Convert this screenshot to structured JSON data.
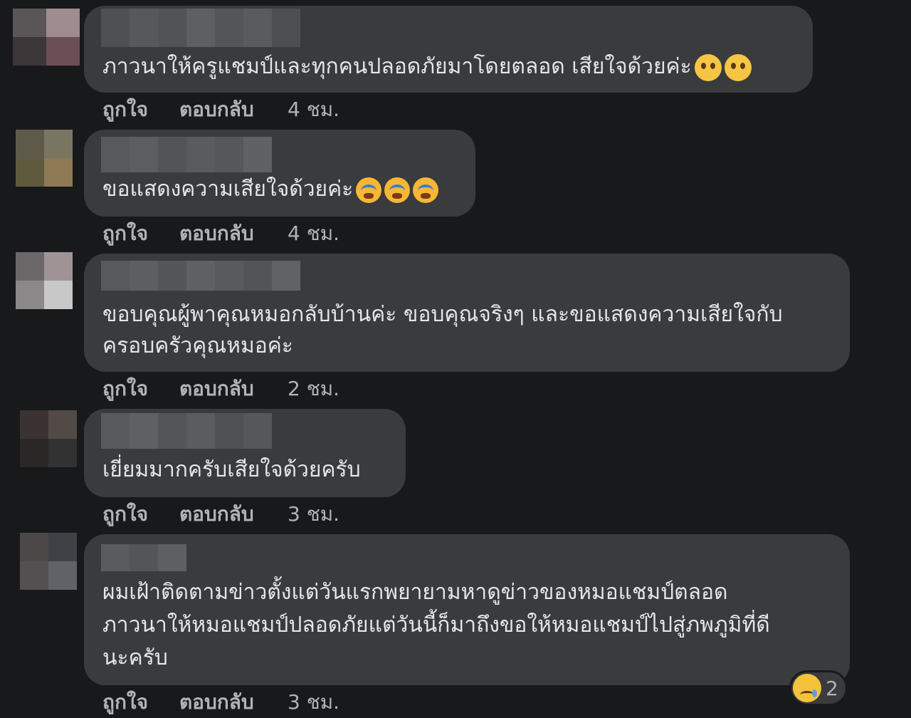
{
  "actions": {
    "like": "ถูกใจ",
    "reply": "ตอบกลับ"
  },
  "comments": [
    {
      "lines": [
        "ภาวนาให้ครูแชมป์และทุกคนปลอดภัยมาโดยตลอด เสียใจด้วยค่ะ"
      ],
      "emoji": "pleading-face x2",
      "time": "4 ชม."
    },
    {
      "lines": [
        "ขอแสดงความเสียใจด้วยค่ะ"
      ],
      "emoji": "loudly-crying-face x3",
      "time": "4 ชม."
    },
    {
      "lines": [
        "ขอบคุณผู้พาคุณหมอกลับบ้านค่ะ ขอบคุณจริงๆ และขอแสดงความเสียใจกับ",
        "ครอบครัวคุณหมอค่ะ"
      ],
      "time": "2 ชม."
    },
    {
      "lines": [
        "เยี่ยมมากครับเสียใจด้วยครับ"
      ],
      "time": "3 ชม."
    },
    {
      "lines": [
        "ผมเฝ้าติดตามข่าวตั้งแต่วันแรกพยายามหาดูข่าวของหมอแชมป์ตลอด",
        "ภาวนาให้หมอแชมป์ปลอดภัยแต่วันนี้ก็มาถึงขอให้หมอแชมป์ไปสู่ภพภูมิที่ดี",
        "นะครับ"
      ],
      "time": "3 ชม.",
      "reaction": {
        "icon": "sad-face",
        "count": "2"
      }
    }
  ],
  "colors": {
    "background": "#18191a",
    "bubble": "#3a3b3c",
    "text": "#e4e6eb",
    "secondary_text": "#b0b3b8"
  }
}
